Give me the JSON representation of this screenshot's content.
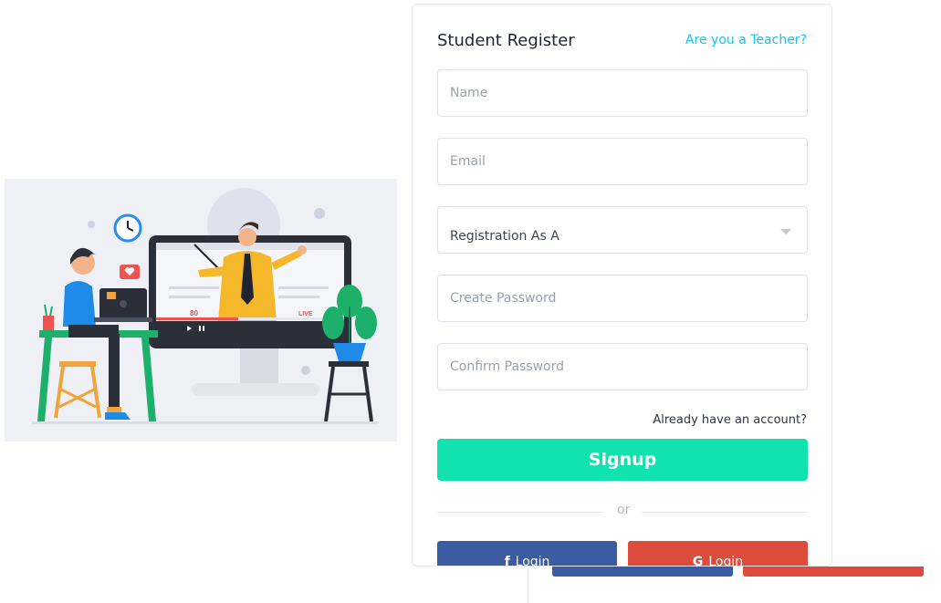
{
  "form": {
    "title": "Student Register",
    "teacher_link": "Are you a Teacher?",
    "name_placeholder": "Name",
    "email_placeholder": "Email",
    "registration_label": "Registration As A",
    "create_password_placeholder": "Create Password",
    "confirm_password_placeholder": "Confirm Password",
    "already_account": "Already have an account?",
    "signup_label": "Signup",
    "or_label": "or",
    "facebook_login": "Login",
    "google_login": "Login"
  },
  "illustration": {
    "viewer_count": "80",
    "live_badge": "LIVE"
  },
  "icons": {
    "facebook": "facebook-icon",
    "google": "google-icon",
    "caret": "chevron-down-icon"
  },
  "colors": {
    "accent": "#10e3ad",
    "link": "#14c3f0",
    "facebook": "#3b5ba3",
    "google": "#dc4b3b"
  }
}
